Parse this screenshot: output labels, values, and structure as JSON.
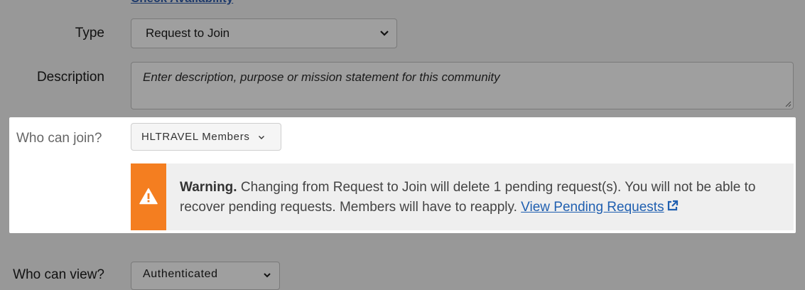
{
  "top_link": {
    "label": "Check Availability"
  },
  "type_field": {
    "label": "Type",
    "value": "Request to Join"
  },
  "description_field": {
    "label": "Description",
    "placeholder": "Enter description, purpose or mission statement for this community"
  },
  "join_field": {
    "label": "Who can join?",
    "value": "HLTRAVEL Members"
  },
  "warning": {
    "title": "Warning.",
    "message": "Changing from Request to Join will delete 1 pending request(s). You will not be able to recover pending requests. Members will have to reapply.",
    "link_label": "View Pending Requests"
  },
  "view_field": {
    "label": "Who can view?",
    "value": "Authenticated"
  },
  "colors": {
    "overlay": "#989898",
    "warning_accent": "#f47e20",
    "link": "#1f5fb0"
  }
}
